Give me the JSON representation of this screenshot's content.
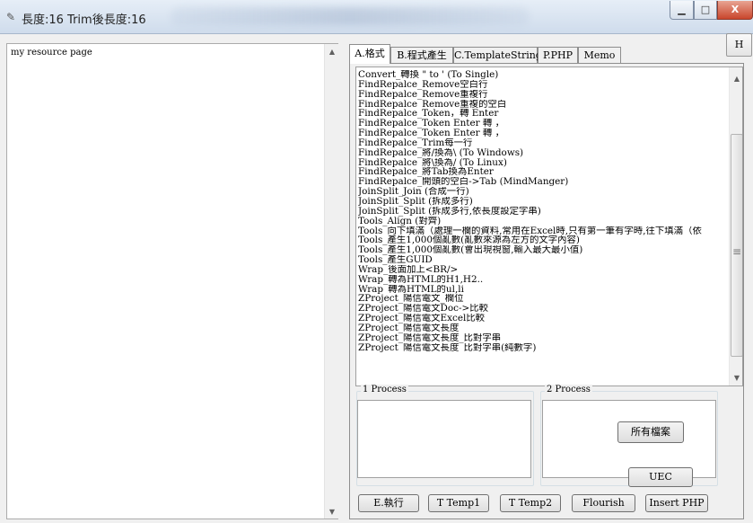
{
  "window": {
    "title": "長度:16 Trim後長度:16",
    "icon": "pencil-icon",
    "minimize": "▁",
    "maximize": "□",
    "close": "X"
  },
  "left_pane": {
    "text": "my resource page"
  },
  "tabs": [
    {
      "label": "A.格式",
      "active": true
    },
    {
      "label": "B.程式產生",
      "active": false
    },
    {
      "label": "C.TemplateString",
      "active": false
    },
    {
      "label": "P.PHP",
      "active": false
    },
    {
      "label": "Memo",
      "active": false
    }
  ],
  "h_button": "H",
  "list_items": [
    "Convert_轉換 \" to ' (To Single)",
    "FindRepalce_Remove空白行",
    "FindRepalce_Remove重複行",
    "FindRepalce_Remove重複的空白",
    "FindRepalce_Token，轉 Enter",
    "FindRepalce_Token Enter 轉 ，",
    "FindRepalce_Token Enter 轉 ，",
    "FindRepalce_Trim每一行",
    "FindRepalce_將/換為\\ (To Windows)",
    "FindRepalce_將\\換為/ (To Linux)",
    "FindRepalce_將Tab換為Enter",
    "FindRepalce_開頭的空白->Tab (MindManger)",
    "JoinSplit_Join (合成一行)",
    "JoinSplit_Split (拆成多行)",
    "JoinSplit_Split (拆成多行,依長度設定字串)",
    "Tools_Align (對齊)",
    "Tools_向下填滿（處理一欄的資料,常用在Excel時,只有第一筆有字時,往下填滿（依",
    "Tools_產生1,000個亂數(亂數來源為左方的文字內容)",
    "Tools_產生1,000個亂數(會出現視窗,輸入最大最小值)",
    "Tools_產生GUID",
    "Wrap_後面加上<BR/>",
    "Wrap_轉為HTML的H1,H2..",
    "Wrap_轉為HTML的ul,li",
    "ZProject_陽信電文_欄位",
    "ZProject_陽信電文Doc->比較",
    "ZProject_陽信電文Excel比較",
    "ZProject_陽信電文長度",
    "ZProject_陽信電文長度_比對字串",
    "ZProject_陽信電文長度_比對字串(純數字)"
  ],
  "groups": {
    "process1": {
      "title": "1 Process"
    },
    "process2": {
      "title": "2 Process",
      "all_files": "所有檔案",
      "uec": "UEC"
    }
  },
  "buttons": {
    "execute": "E.執行",
    "temp1": "T Temp1",
    "temp2": "T Temp2",
    "flourish": "Flourish",
    "insert_php": "Insert PHP"
  },
  "scroll": {
    "up": "▲",
    "down": "▼"
  }
}
